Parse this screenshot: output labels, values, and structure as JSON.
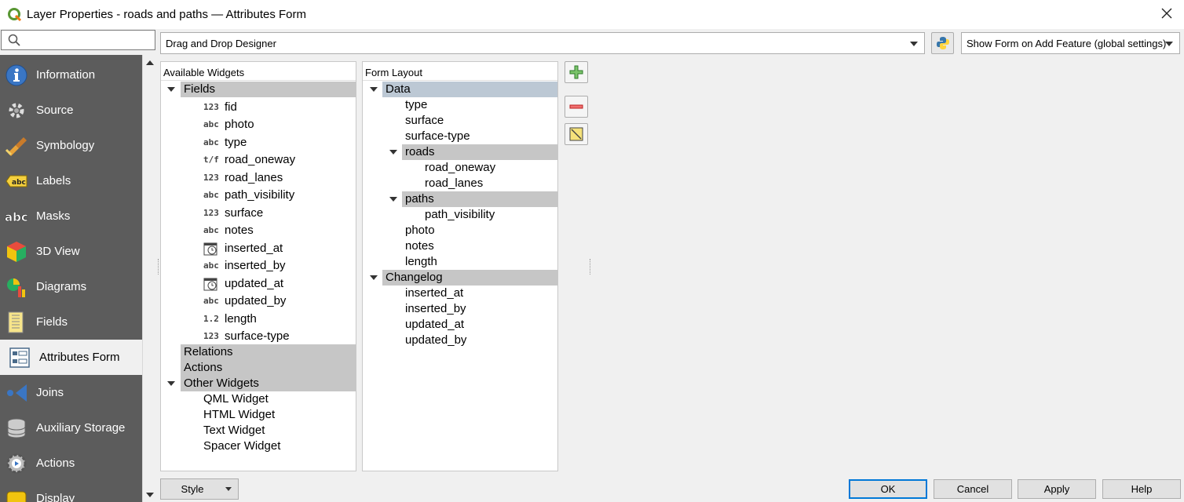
{
  "window": {
    "title": "Layer Properties - roads and paths — Attributes Form"
  },
  "search": {
    "placeholder": ""
  },
  "sidebar": {
    "items": [
      {
        "label": "Information",
        "icon": "information-icon"
      },
      {
        "label": "Source",
        "icon": "source-icon"
      },
      {
        "label": "Symbology",
        "icon": "symbology-icon"
      },
      {
        "label": "Labels",
        "icon": "labels-icon"
      },
      {
        "label": "Masks",
        "icon": "masks-icon"
      },
      {
        "label": "3D View",
        "icon": "3d-view-icon"
      },
      {
        "label": "Diagrams",
        "icon": "diagrams-icon"
      },
      {
        "label": "Fields",
        "icon": "fields-icon"
      },
      {
        "label": "Attributes Form",
        "icon": "attributes-form-icon",
        "active": true
      },
      {
        "label": "Joins",
        "icon": "joins-icon"
      },
      {
        "label": "Auxiliary Storage",
        "icon": "auxiliary-storage-icon"
      },
      {
        "label": "Actions",
        "icon": "actions-icon"
      },
      {
        "label": "Display",
        "icon": "display-icon"
      }
    ]
  },
  "designer": {
    "mode": "Drag and Drop Designer",
    "show_form": "Show Form on Add Feature (global settings)"
  },
  "available": {
    "header": "Available Widgets",
    "fields_label": "Fields",
    "fields": [
      {
        "type": "123",
        "name": "fid"
      },
      {
        "type": "abc",
        "name": "photo"
      },
      {
        "type": "abc",
        "name": "type"
      },
      {
        "type": "t/f",
        "name": "road_oneway"
      },
      {
        "type": "123",
        "name": "road_lanes"
      },
      {
        "type": "abc",
        "name": "path_visibility"
      },
      {
        "type": "123",
        "name": "surface"
      },
      {
        "type": "abc",
        "name": "notes"
      },
      {
        "type": "datetime",
        "name": "inserted_at"
      },
      {
        "type": "abc",
        "name": "inserted_by"
      },
      {
        "type": "datetime",
        "name": "updated_at"
      },
      {
        "type": "abc",
        "name": "updated_by"
      },
      {
        "type": "1.2",
        "name": "length"
      },
      {
        "type": "123",
        "name": "surface-type"
      }
    ],
    "relations_label": "Relations",
    "actions_label": "Actions",
    "other_label": "Other Widgets",
    "other": [
      "QML Widget",
      "HTML Widget",
      "Text Widget",
      "Spacer Widget"
    ]
  },
  "layout": {
    "header": "Form Layout",
    "rows": [
      {
        "label": "Data",
        "level": 0,
        "group": true,
        "expanded": true,
        "selected": true
      },
      {
        "label": "type",
        "level": 1
      },
      {
        "label": "surface",
        "level": 1
      },
      {
        "label": "surface-type",
        "level": 1
      },
      {
        "label": "roads",
        "level": 1,
        "group": true,
        "expanded": true
      },
      {
        "label": "road_oneway",
        "level": 2
      },
      {
        "label": "road_lanes",
        "level": 2
      },
      {
        "label": "paths",
        "level": 1,
        "group": true,
        "expanded": true
      },
      {
        "label": "path_visibility",
        "level": 2
      },
      {
        "label": "photo",
        "level": 1
      },
      {
        "label": "notes",
        "level": 1
      },
      {
        "label": "length",
        "level": 1
      },
      {
        "label": "Changelog",
        "level": 0,
        "group": true,
        "expanded": true
      },
      {
        "label": "inserted_at",
        "level": 1
      },
      {
        "label": "inserted_by",
        "level": 1
      },
      {
        "label": "updated_at",
        "level": 1
      },
      {
        "label": "updated_by",
        "level": 1
      }
    ]
  },
  "buttons": {
    "style": "Style",
    "ok": "OK",
    "cancel": "Cancel",
    "apply": "Apply",
    "help": "Help"
  },
  "colors": {
    "sidebar_bg": "#5c5c5c",
    "group_bg": "#c6c6c6",
    "selected_bg": "#bcc8d4",
    "default_button_border": "#0078d7"
  }
}
